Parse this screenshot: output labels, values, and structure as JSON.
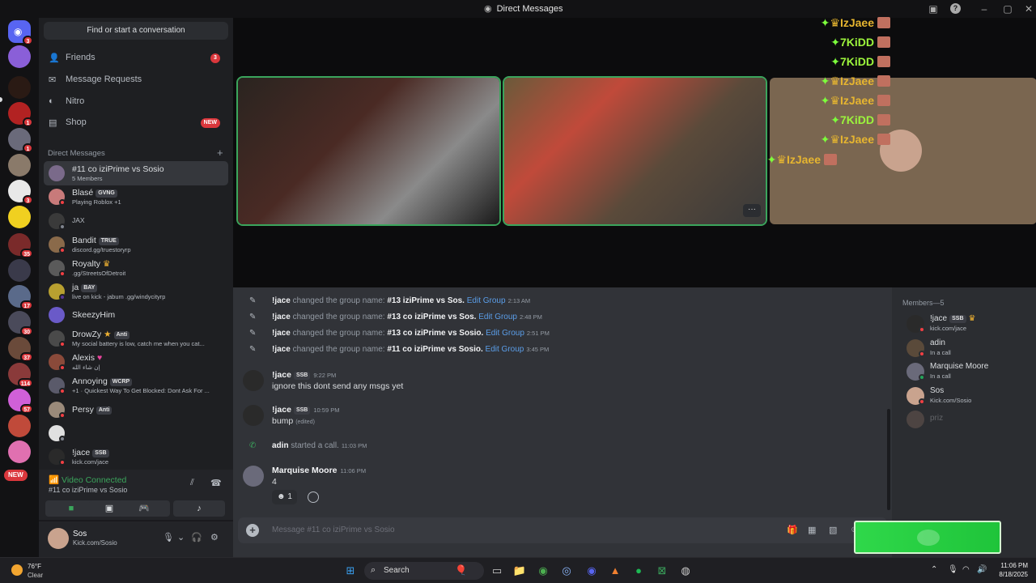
{
  "window": {
    "title": "Direct Messages"
  },
  "rail": {
    "badges": [
      "3",
      "1",
      "1",
      "3",
      "35",
      "17",
      "30",
      "37",
      "114",
      "57"
    ],
    "new_label": "NEW"
  },
  "sidebar": {
    "search_label": "Find or start a conversation",
    "nav": [
      {
        "label": "Friends",
        "icon": "friends-icon",
        "count": "3"
      },
      {
        "label": "Message Requests",
        "icon": "mail-icon"
      },
      {
        "label": "Nitro",
        "icon": "nitro-icon"
      },
      {
        "label": "Shop",
        "icon": "shop-icon",
        "badge": "NEW"
      }
    ],
    "dm_header": "Direct Messages",
    "dms": [
      {
        "name": "#11 co iziPrime vs Sosio",
        "sub": "5 Members"
      },
      {
        "name": "Blasé",
        "tag": "GVNG",
        "sub": "Playing Roblox +1"
      },
      {
        "name": "JAX"
      },
      {
        "name": "Bandit",
        "tag": "TRUE",
        "sub": "discord.gg/truestoryrp"
      },
      {
        "name": "Royalty",
        "sub": ".gg/StreetsOfDetroit"
      },
      {
        "name": "ja",
        "tag": "BAY",
        "sub": "live on kick - jabum .gg/windycityrp"
      },
      {
        "name": "SkeezyHim"
      },
      {
        "name": "DrowZy",
        "tag": "Anti",
        "sub": "My social battery is low, catch me when you cat..."
      },
      {
        "name": "Alexis",
        "sub": "إن شاء الله"
      },
      {
        "name": "Annoying",
        "tag": "WCRP",
        "sub": "+1 · Quickest Way To Get Blocked: Dont Ask For ..."
      },
      {
        "name": "Persy",
        "tag": "Anti"
      },
      {
        "name": ""
      },
      {
        "name": "!jace",
        "tag": "SSB",
        "sub": "kick.com/jace"
      }
    ]
  },
  "voice": {
    "status": "Video Connected",
    "channel": "#11 co iziPrime vs Sosio"
  },
  "user": {
    "name": "Sos",
    "status": "Kick.com/Sosio"
  },
  "call_chat": [
    {
      "name": "IzJaee",
      "color": "y"
    },
    {
      "name": "7KiDD",
      "color": "g"
    },
    {
      "name": "7KiDD",
      "color": "g"
    },
    {
      "name": "IzJaee",
      "color": "y"
    },
    {
      "name": "IzJaee",
      "color": "y"
    },
    {
      "name": "7KiDD",
      "color": "g"
    },
    {
      "name": "IzJaee",
      "color": "y"
    },
    {
      "name": "IzJaee",
      "color": "y"
    }
  ],
  "messages": {
    "system": [
      {
        "user": "!jace",
        "text": "changed the group name:",
        "value": "#13 iziPrime vs Sos.",
        "link": "Edit Group",
        "time": "2:13 AM"
      },
      {
        "user": "!jace",
        "text": "changed the group name:",
        "value": "#13 co iziPrime vs Sos.",
        "link": "Edit Group",
        "time": "2:48 PM"
      },
      {
        "user": "!jace",
        "text": "changed the group name:",
        "value": "#13 co iziPrime vs Sosio.",
        "link": "Edit Group",
        "time": "2:51 PM"
      },
      {
        "user": "!jace",
        "text": "changed the group name:",
        "value": "#11 co iziPrime vs Sosio.",
        "link": "Edit Group",
        "time": "3:45 PM"
      }
    ],
    "m1": {
      "user": "!jace",
      "tag": "SSB",
      "time": "9:22 PM",
      "text": "ignore this dont send any msgs yet"
    },
    "m2": {
      "user": "!jace",
      "tag": "SSB",
      "time": "10:59 PM",
      "text": "bump",
      "edited": "(edited)"
    },
    "call": {
      "user": "adin",
      "text": "started a call.",
      "time": "11:03 PM"
    },
    "m3": {
      "user": "Marquise Moore",
      "time": "11:06 PM",
      "text": "4",
      "reaction_count": "1"
    }
  },
  "input": {
    "placeholder": "Message #11 co iziPrime vs Sosio"
  },
  "members": {
    "header": "Members—5",
    "list": [
      {
        "name": "!jace",
        "tag": "SSB",
        "sub": "kick.com/jace"
      },
      {
        "name": "adin",
        "sub": "In a call"
      },
      {
        "name": "Marquise Moore",
        "sub": "In a call"
      },
      {
        "name": "Sos",
        "sub": "Kick.com/Sosio"
      },
      {
        "name": "priz"
      }
    ]
  },
  "taskbar": {
    "temp": "76°F",
    "condition": "Clear",
    "search": "Search",
    "time": "11:06 PM",
    "date": "8/18/2025"
  }
}
